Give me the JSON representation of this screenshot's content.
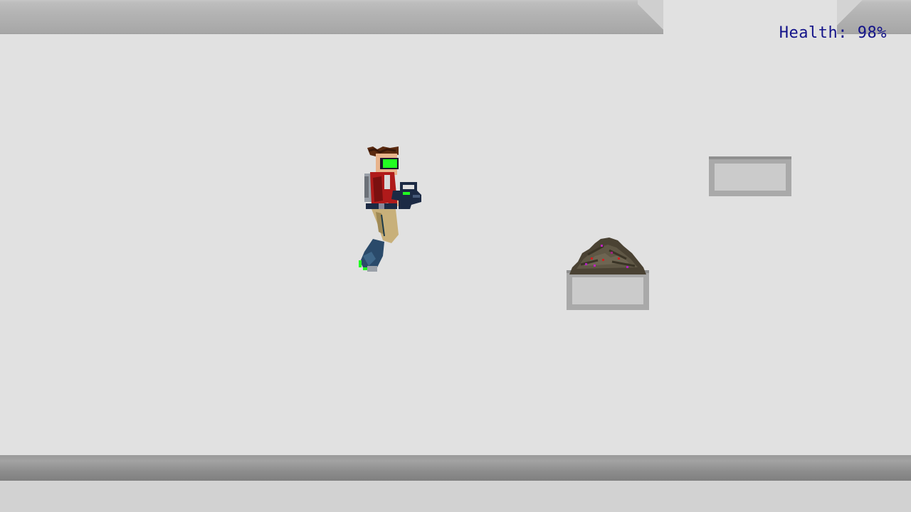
{
  "hud": {
    "health_label": "Health:",
    "health_value": "98%",
    "health_color": "#131389"
  },
  "colors": {
    "background": "#e1e1e1",
    "ceiling": "#b3b3b3",
    "floor": "#8e8e8e",
    "platform": "#a9a9a9",
    "player_visor": "#22ff22",
    "player_jacket": "#b01a1a"
  },
  "entities": {
    "player": "player-soldier-icon",
    "pile": "rubble-pile-icon"
  }
}
